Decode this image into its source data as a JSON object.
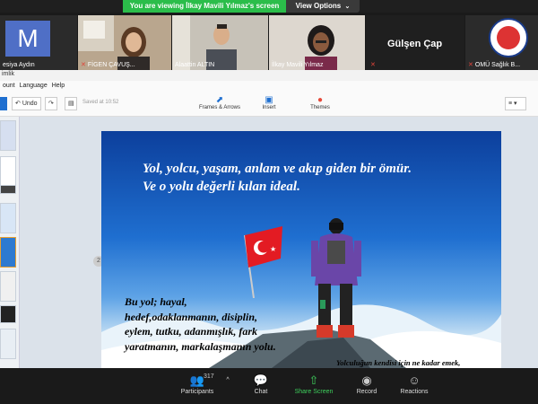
{
  "share_banner": {
    "viewing_text": "You are viewing İlkay Mavili Yılmaz's screen",
    "view_options": "View Options"
  },
  "participants": [
    {
      "name": "esiya Aydın",
      "muted": false,
      "avatar_letter": "M",
      "type": "avatar"
    },
    {
      "name": "FİGEN ÇAVUŞ...",
      "muted": true,
      "type": "video"
    },
    {
      "name": "Alaattin ALTIN",
      "muted": false,
      "type": "video"
    },
    {
      "name": "İlkay Mavili Yılmaz",
      "muted": true,
      "type": "video"
    },
    {
      "name": "Gülşen Çap",
      "muted": true,
      "type": "name-only"
    },
    {
      "name": "OMÜ Sağlık B...",
      "muted": true,
      "type": "logo"
    }
  ],
  "app": {
    "title_fragment": "imlik",
    "menu": [
      "ount",
      "Language",
      "Help"
    ]
  },
  "toolbar": {
    "undo": "Undo",
    "saved_text": "Saved at 10:52",
    "frames": "Frames & Arrows",
    "insert": "Insert",
    "themes": "Themes"
  },
  "workspace": {
    "page_number": "2"
  },
  "slide": {
    "title_line1": "Yol, yolcu, yaşam, anlam ve akıp giden bir ömür.",
    "title_line2": "Ve o yolu değerli kılan ideal.",
    "body": "Bu yol; hayal, hedef,odaklanmanın, disiplin, eylem, tutku, adanmışlık, fark yaratmanın, markalaşmanın yolu.",
    "footer": "Yolculuğun kendisi için ne kadar emek,"
  },
  "bottom_bar": {
    "participants_label": "Participants",
    "participants_count": "317",
    "chat_label": "Chat",
    "share_label": "Share Screen",
    "record_label": "Record",
    "reactions_label": "Reactions"
  },
  "colors": {
    "accent_green": "#2bbd4a",
    "muted_red": "#e0443a",
    "avatar_blue": "#4f6fc6",
    "sky_blue": "#1f6fd0"
  }
}
